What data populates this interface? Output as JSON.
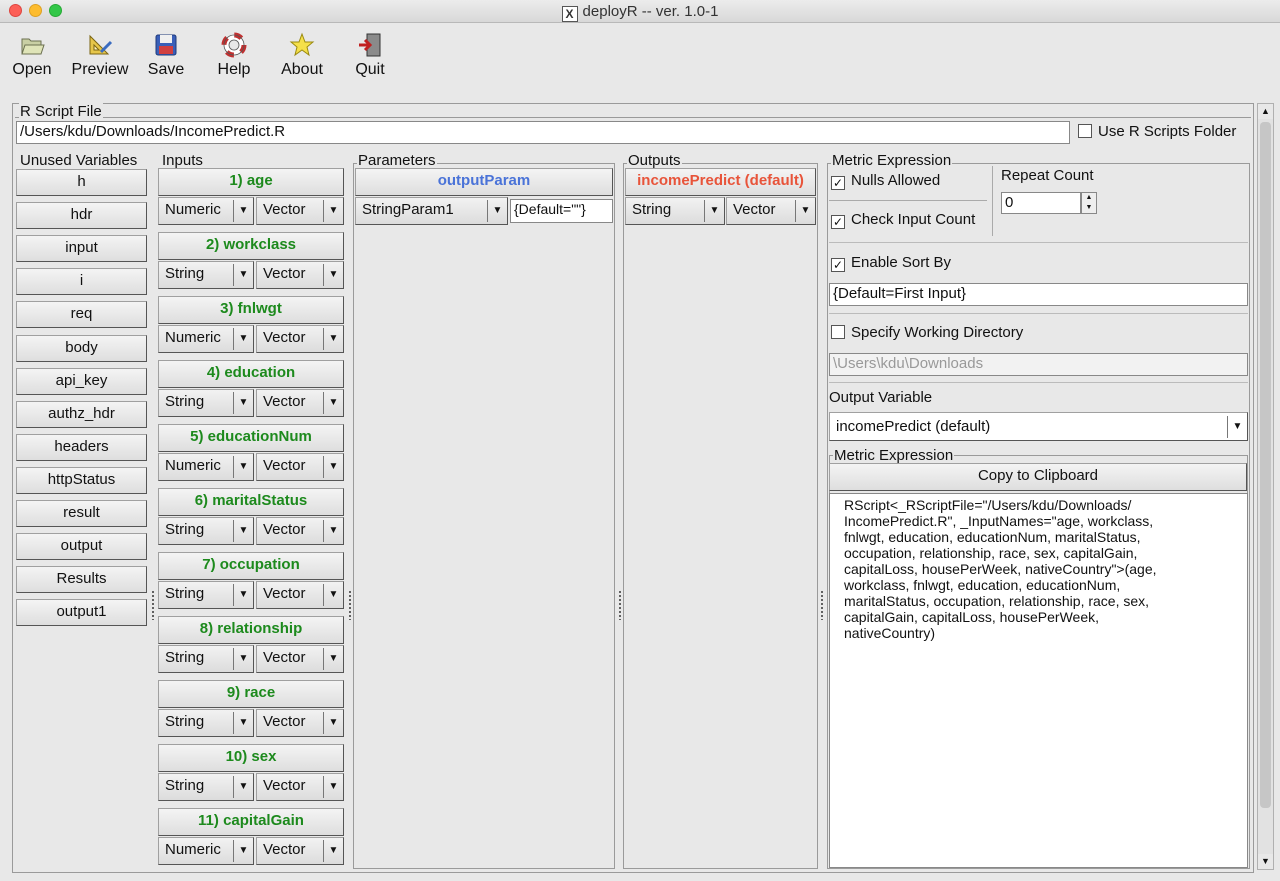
{
  "window": {
    "title": "deployR -- ver. 1.0-1"
  },
  "toolbar": [
    {
      "label": "Open",
      "icon": "folder-icon"
    },
    {
      "label": "Preview",
      "icon": "preview-icon"
    },
    {
      "label": "Save",
      "icon": "save-icon"
    },
    {
      "label": "Help",
      "icon": "lifebuoy-icon"
    },
    {
      "label": "About",
      "icon": "star-icon"
    },
    {
      "label": "Quit",
      "icon": "exit-icon"
    }
  ],
  "script_file": {
    "group_label": "R Script File",
    "path": "/Users/kdu/Downloads/IncomePredict.R",
    "use_folder_label": "Use R Scripts Folder",
    "use_folder_checked": false
  },
  "unused_variables": {
    "label": "Unused Variables",
    "items": [
      "h",
      "hdr",
      "input",
      "i",
      "req",
      "body",
      "api_key",
      "authz_hdr",
      "headers",
      "httpStatus",
      "result",
      "output",
      "Results",
      "output1"
    ]
  },
  "inputs": {
    "label": "Inputs",
    "items": [
      {
        "name": "1) age",
        "type": "Numeric",
        "shape": "Vector"
      },
      {
        "name": "2) workclass",
        "type": "String",
        "shape": "Vector"
      },
      {
        "name": "3) fnlwgt",
        "type": "Numeric",
        "shape": "Vector"
      },
      {
        "name": "4) education",
        "type": "String",
        "shape": "Vector"
      },
      {
        "name": "5) educationNum",
        "type": "Numeric",
        "shape": "Vector"
      },
      {
        "name": "6) maritalStatus",
        "type": "String",
        "shape": "Vector"
      },
      {
        "name": "7) occupation",
        "type": "String",
        "shape": "Vector"
      },
      {
        "name": "8) relationship",
        "type": "String",
        "shape": "Vector"
      },
      {
        "name": "9) race",
        "type": "String",
        "shape": "Vector"
      },
      {
        "name": "10) sex",
        "type": "String",
        "shape": "Vector"
      },
      {
        "name": "11) capitalGain",
        "type": "Numeric",
        "shape": "Vector"
      }
    ]
  },
  "parameters": {
    "label": "Parameters",
    "header": "outputParam",
    "type": "StringParam1",
    "default_value": "{Default=\"\"}"
  },
  "outputs": {
    "label": "Outputs",
    "header": "incomePredict (default)",
    "type": "String",
    "shape": "Vector"
  },
  "metric": {
    "label": "Metric Expression",
    "nulls_allowed_label": "Nulls Allowed",
    "nulls_allowed": true,
    "check_input_count_label": "Check Input Count",
    "check_input_count": true,
    "repeat_count_label": "Repeat Count",
    "repeat_count": "0",
    "enable_sort_label": "Enable Sort By",
    "enable_sort": true,
    "sort_value": "{Default=First Input}",
    "working_dir_label": "Specify Working Directory",
    "working_dir_checked": false,
    "working_dir": "\\Users\\kdu\\Downloads",
    "output_variable_label": "Output Variable",
    "output_variable": "incomePredict (default)",
    "expression_label": "Metric Expression",
    "copy_label": "Copy to Clipboard",
    "expression": "RScript<_RScriptFile=\"/Users/kdu/Downloads/\nIncomePredict.R\", _InputNames=\"age, workclass,\nfnlwgt, education, educationNum, maritalStatus,\noccupation, relationship, race, sex, capitalGain,\ncapitalLoss, housePerWeek, nativeCountry\">(age,\nworkclass, fnlwgt, education, educationNum,\nmaritalStatus, occupation, relationship, race, sex,\ncapitalGain, capitalLoss, housePerWeek,\nnativeCountry)"
  },
  "check_mark": "✓"
}
